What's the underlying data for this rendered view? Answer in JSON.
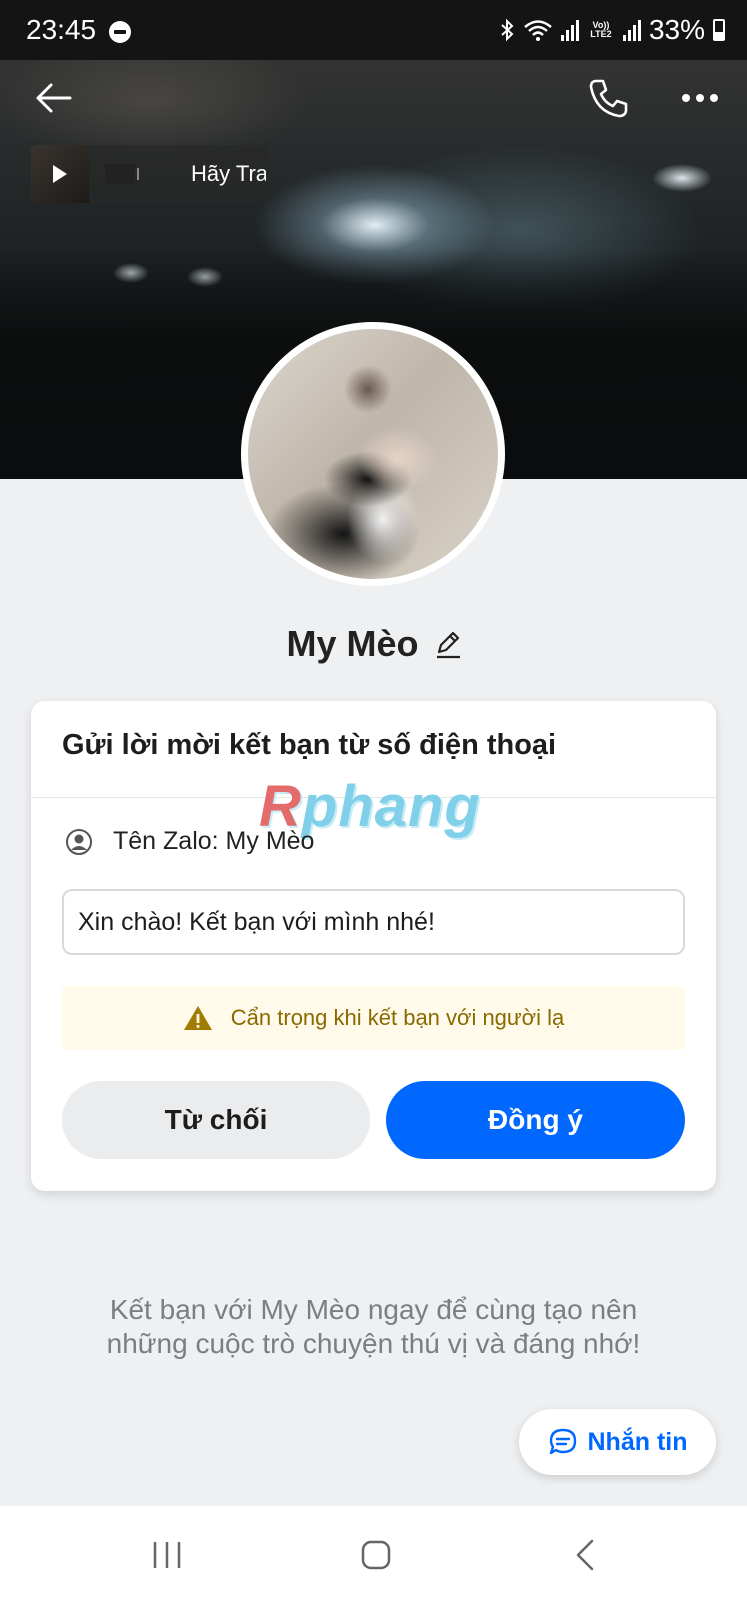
{
  "status_bar": {
    "time": "23:45",
    "volte_label": "Vo)) LTE2",
    "battery": "33%"
  },
  "header": {
    "back_icon": "arrow-left-icon",
    "call_icon": "phone-icon",
    "more_icon": "more-dots-icon"
  },
  "music": {
    "title": "Hãy Trao"
  },
  "profile": {
    "name": "My Mèo"
  },
  "request_card": {
    "title": "Gửi lời mời kết bạn từ số điện thoại",
    "watermark": "Rphang",
    "zalo_name_label": "Tên Zalo: My Mèo",
    "message_value": "Xin chào! Kết bạn với mình nhé!",
    "warning_text": "Cẩn trọng khi kết bạn với người lạ",
    "decline_label": "Từ chối",
    "accept_label": "Đồng ý"
  },
  "footer_note": {
    "line1": "Kết bạn với My Mèo ngay để cùng tạo nên",
    "line2": "những cuộc trò chuyện thú vị và đáng nhớ!"
  },
  "chat_button": {
    "label": "Nhắn tin"
  },
  "colors": {
    "accent": "#0068ff",
    "warning_bg": "#fffaea",
    "warning_text": "#8a6a00",
    "page_bg": "#eef0f2"
  }
}
